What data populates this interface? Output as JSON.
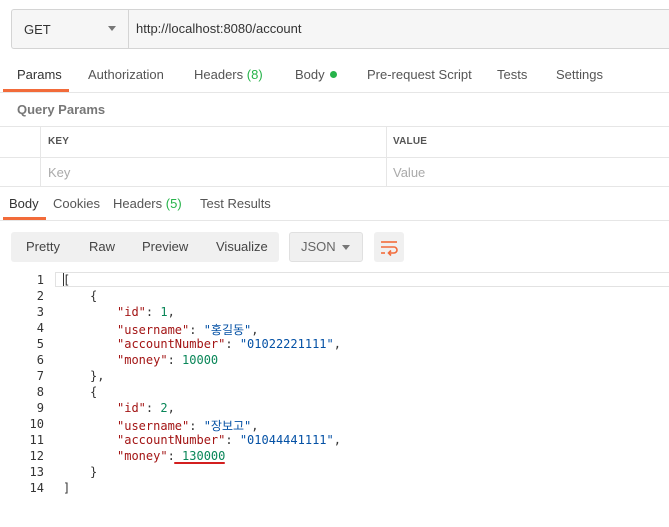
{
  "request": {
    "method": "GET",
    "url": "http://localhost:8080/account"
  },
  "request_tabs": {
    "params": "Params",
    "authorization": "Authorization",
    "headers": "Headers",
    "headers_count": "(8)",
    "body": "Body",
    "pre_request": "Pre-request Script",
    "tests": "Tests",
    "settings": "Settings"
  },
  "query_params": {
    "title": "Query Params",
    "col_key": "KEY",
    "col_value": "VALUE",
    "key_placeholder": "Key",
    "value_placeholder": "Value"
  },
  "response_tabs": {
    "body": "Body",
    "cookies": "Cookies",
    "headers": "Headers",
    "headers_count": "(5)",
    "test_results": "Test Results"
  },
  "view_modes": {
    "pretty": "Pretty",
    "raw": "Raw",
    "preview": "Preview",
    "visualize": "Visualize"
  },
  "format": "JSON",
  "icons": {
    "wrap": "wrap-lines-icon",
    "caret": "chevron-down-icon"
  },
  "colors": {
    "accent": "#f26b3a",
    "count_green": "#26b34a",
    "underline_red": "#d31f1f"
  },
  "response_body": {
    "line_numbers": [
      "1",
      "2",
      "3",
      "4",
      "5",
      "6",
      "7",
      "8",
      "9",
      "10",
      "11",
      "12",
      "13",
      "14"
    ],
    "open_bracket": "[",
    "close_bracket": "]",
    "open_brace": "{",
    "close_brace_comma": "},",
    "close_brace": "}",
    "records": [
      {
        "id_key": "\"id\"",
        "id_val": "1",
        "username_key": "\"username\"",
        "username_val": "\"홍길동\"",
        "account_key": "\"accountNumber\"",
        "account_val": "\"01022221111\"",
        "money_key": "\"money\"",
        "money_val": "10000"
      },
      {
        "id_key": "\"id\"",
        "id_val": "2",
        "username_key": "\"username\"",
        "username_val": "\"장보고\"",
        "account_key": "\"accountNumber\"",
        "account_val": "\"01044441111\"",
        "money_key": "\"money\"",
        "money_val": "130000"
      }
    ]
  }
}
